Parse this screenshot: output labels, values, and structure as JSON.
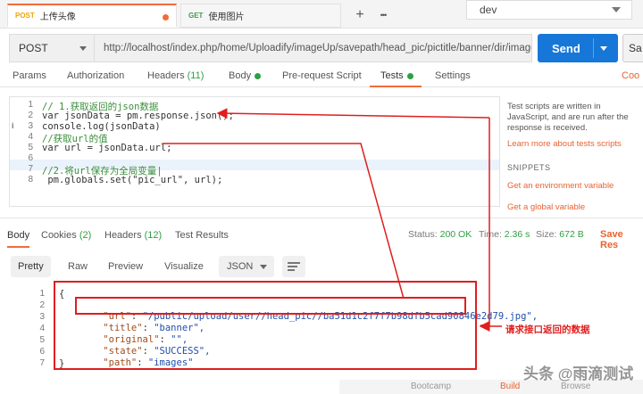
{
  "tabs": [
    {
      "method": "POST",
      "name": "上传头像",
      "active": true
    },
    {
      "method": "GET",
      "name": "使用图片",
      "active": false
    }
  ],
  "tab_controls": {
    "add": "+",
    "more": "•••"
  },
  "environment": {
    "selected": "dev"
  },
  "request": {
    "method": "POST",
    "url": "http://localhost/index.php/home/Uploadify/imageUp/savepath/head_pic/pictitle/banner/dir/images",
    "send_label": "Send",
    "save_label": "Sa"
  },
  "request_tabs": [
    {
      "label": "Params"
    },
    {
      "label": "Authorization"
    },
    {
      "label": "Headers",
      "count": "(11)"
    },
    {
      "label": "Body"
    },
    {
      "label": "Pre-request Script"
    },
    {
      "label": "Tests"
    },
    {
      "label": "Settings"
    },
    {
      "label": "Coo"
    }
  ],
  "editor": {
    "lines": [
      {
        "n": "1",
        "text": "// 1.获取返回的json数据"
      },
      {
        "n": "2",
        "text": "var jsonData = pm.response.json();"
      },
      {
        "n": "3",
        "text": "console.log(jsonData)"
      },
      {
        "n": "4",
        "text": "//获取url的值"
      },
      {
        "n": "5",
        "text": "var url = jsonData.url;"
      },
      {
        "n": "6",
        "text": ""
      },
      {
        "n": "7",
        "text": "//2.将url保存为全局变量|"
      },
      {
        "n": "8",
        "text": " pm.globals.set(\"pic_url\", url);"
      }
    ],
    "warning_mark": "i"
  },
  "side_panel": {
    "intro": "Test scripts are written in JavaScript, and are run after the response is received.",
    "learn_more": "Learn more about tests scripts",
    "snippets_title": "SNIPPETS",
    "snippets": [
      "Get an environment variable",
      "Get a global variable"
    ]
  },
  "response": {
    "tabs": [
      {
        "label": "Body"
      },
      {
        "label": "Cookies",
        "count": "(2)"
      },
      {
        "label": "Headers",
        "count": "(12)"
      },
      {
        "label": "Test Results"
      }
    ],
    "status_label": "Status:",
    "status_value": "200 OK",
    "time_label": "Time:",
    "time_value": "2.36 s",
    "size_label": "Size:",
    "size_value": "672 B",
    "save_label": "Save Res",
    "view_tabs": [
      "Pretty",
      "Raw",
      "Preview",
      "Visualize"
    ],
    "format": "JSON",
    "body_lines": [
      {
        "n": "1",
        "text": "{"
      },
      {
        "n": "2",
        "key": "\"url\"",
        "value": "\"/public/upload/user//head_pic//ba51d1c2f7f7b98dfb5cad90846e2d79.jpg\","
      },
      {
        "n": "3",
        "key": "\"title\"",
        "value": "\"banner\","
      },
      {
        "n": "4",
        "key": "\"original\"",
        "value": "\"\","
      },
      {
        "n": "5",
        "key": "\"state\"",
        "value": "\"SUCCESS\","
      },
      {
        "n": "6",
        "key": "\"path\"",
        "value": "\"images\""
      },
      {
        "n": "7",
        "text": "}"
      }
    ]
  },
  "annotation": {
    "text": "请求接口返回的数据"
  },
  "footer": {
    "bootcamp": "Bootcamp",
    "build": "Build",
    "browse": "Browse"
  },
  "watermark": "头条 @雨滴测试",
  "colors": {
    "accent": "#f26b3a",
    "send": "#1677d9",
    "annotation": "#e11d1d",
    "ok": "#2ea043"
  }
}
